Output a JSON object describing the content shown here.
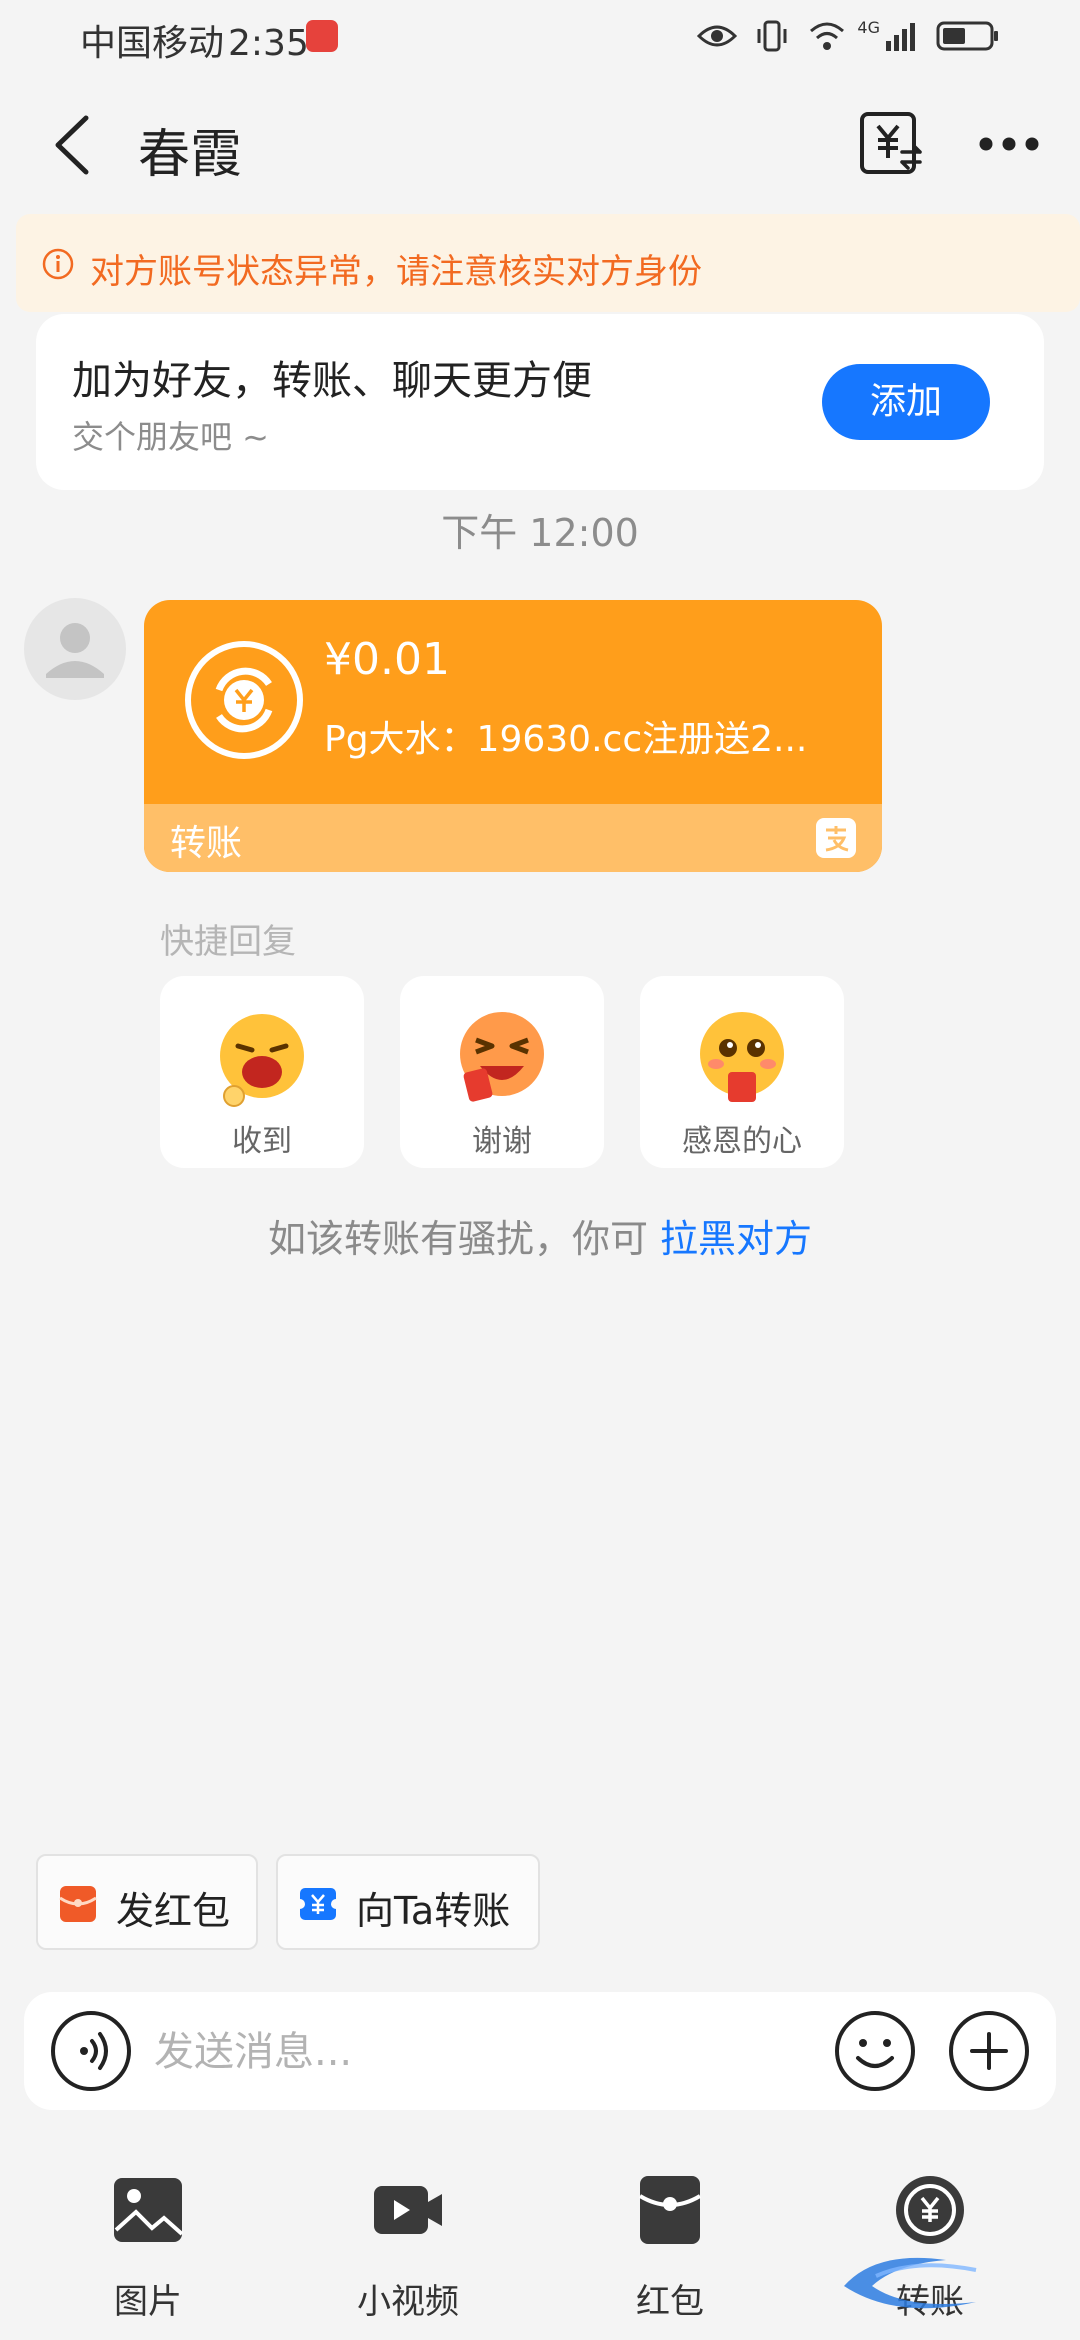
{
  "status_bar": {
    "carrier": "中国移动",
    "time": "2:35",
    "network": "4G"
  },
  "header": {
    "title": "春霞"
  },
  "warning": {
    "text": "对方账号状态异常，请注意核实对方身份"
  },
  "friend_card": {
    "title": "加为好友，转账、聊天更方便",
    "subtitle": "交个朋友吧 ~",
    "button": "添加"
  },
  "message": {
    "time": "下午 12:00",
    "transfer": {
      "amount": "¥0.01",
      "memo": "Pg大水：19630.cc注册送2...",
      "footer_label": "转账"
    }
  },
  "quick_reply": {
    "label": "快捷回复",
    "items": [
      {
        "label": "收到",
        "icon": "ok-hand-emoji-icon"
      },
      {
        "label": "谢谢",
        "icon": "grinning-red-packet-emoji-icon"
      },
      {
        "label": "感恩的心",
        "icon": "grateful-emoji-icon"
      }
    ]
  },
  "block_notice": {
    "text": "如该转账有骚扰，你可 ",
    "link": "拉黑对方"
  },
  "chips": {
    "red_packet": "发红包",
    "transfer": "向Ta转账"
  },
  "input": {
    "placeholder": "发送消息..."
  },
  "tools": [
    {
      "label": "图片",
      "icon": "image-icon"
    },
    {
      "label": "小视频",
      "icon": "video-icon"
    },
    {
      "label": "红包",
      "icon": "red-packet-icon"
    },
    {
      "label": "转账",
      "icon": "transfer-icon"
    }
  ],
  "colors": {
    "accent_blue": "#1677ff",
    "transfer_orange": "#ff9e1b",
    "warning_orange": "#f26a21",
    "red_packet_red": "#f05a28"
  }
}
